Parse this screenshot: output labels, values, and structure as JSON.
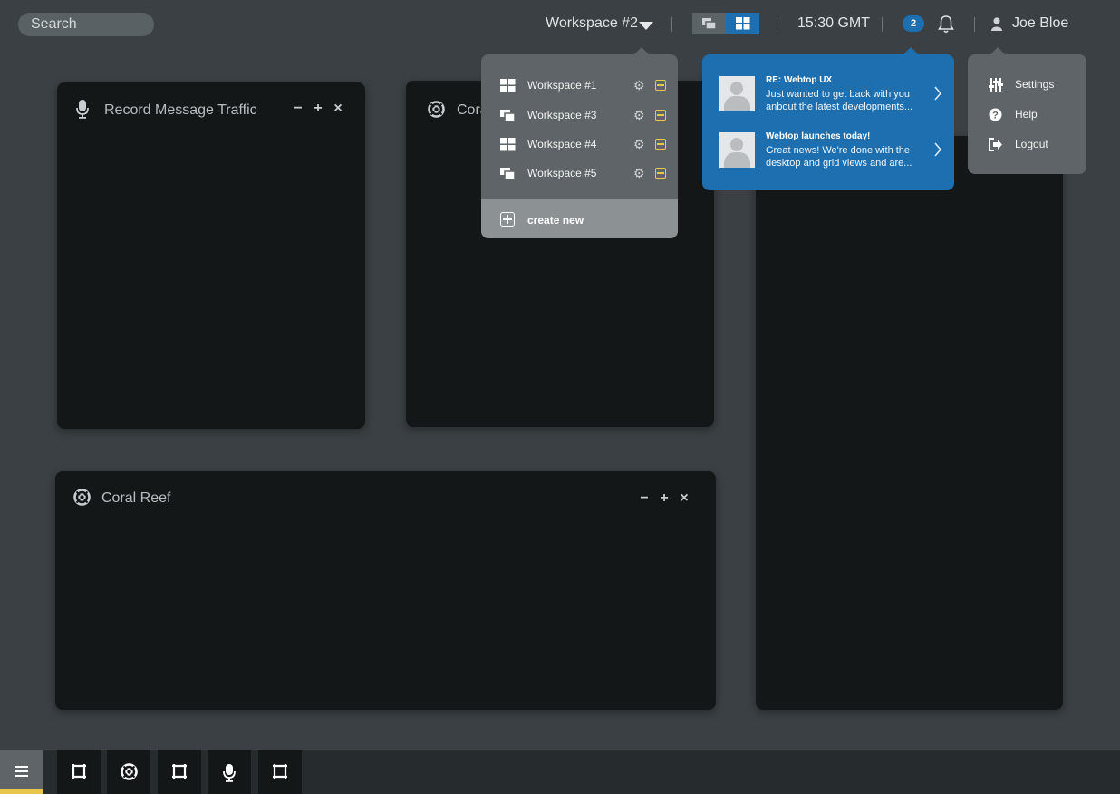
{
  "search": {
    "placeholder": "Search"
  },
  "header": {
    "workspace_label": "Workspace #2",
    "clock": "15:30 GMT",
    "message_count": "2",
    "username": "Joe Bloe"
  },
  "workspace_menu": {
    "items": [
      {
        "label": "Workspace #1",
        "view": "grid"
      },
      {
        "label": "Workspace #3",
        "view": "desktop"
      },
      {
        "label": "Workspace #4",
        "view": "grid"
      },
      {
        "label": "Workspace #5",
        "view": "desktop"
      }
    ],
    "create_label": "create new"
  },
  "messages": [
    {
      "subject": "RE: Webtop UX",
      "line1": "Just wanted to get back with you",
      "line2": "anbout the latest developments..."
    },
    {
      "subject": "Webtop launches today!",
      "line1": "Great news! We're done with the",
      "line2": "desktop and grid views and are..."
    }
  ],
  "user_menu": {
    "items": [
      {
        "label": "Settings",
        "icon": "sliders-icon"
      },
      {
        "label": "Help",
        "icon": "help-icon"
      },
      {
        "label": "Logout",
        "icon": "logout-icon"
      }
    ]
  },
  "widgets": [
    {
      "title": "Record Message Traffic",
      "icon": "microphone-icon"
    },
    {
      "title": "Cora",
      "icon": "life-ring-icon"
    },
    {
      "title": "Coral Reef",
      "icon": "life-ring-icon"
    }
  ],
  "colors": {
    "accent": "#1d6fb0",
    "highlight": "#e8c64c",
    "background": "#3a4043",
    "widget": "#131718"
  }
}
